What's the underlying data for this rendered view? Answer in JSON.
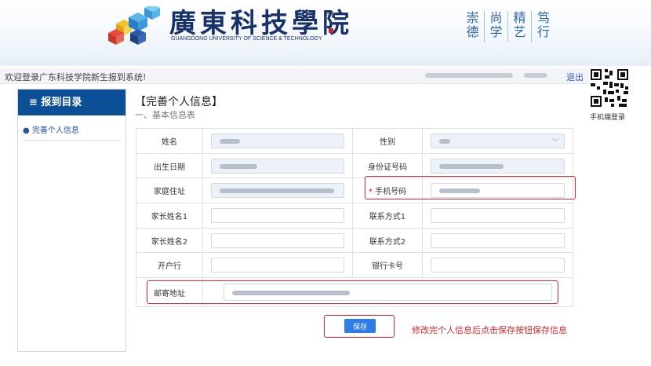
{
  "header": {
    "school_name": "廣東科技學院",
    "school_name_en": "GUANGDONG UNIVERSITY OF SCIENCE & TECHNOLOGY",
    "seal_text_a": "崇",
    "seal_text_b": "德",
    "motto": [
      "崇德",
      "尚学",
      "精艺",
      "笃行"
    ]
  },
  "topbar": {
    "welcome": "欢迎登录广东科技学院新生报到系统!",
    "logout_label": "退出",
    "qr_label": "手机端登录"
  },
  "sidebar": {
    "title": "≡ 报到目录",
    "items": [
      {
        "label": "● 完善个人信息"
      }
    ]
  },
  "section": {
    "title": "【完善个人信息】",
    "subtitle": "一、基本信息表"
  },
  "form": {
    "labels": {
      "name": "姓名",
      "gender": "性别",
      "birth": "出生日期",
      "id_no": "身份证号码",
      "home": "家庭住址",
      "phone_required_mark": "*",
      "phone": "手机号码",
      "parent1": "家长姓名1",
      "contact1": "联系方式1",
      "parent2": "家长姓名2",
      "contact2": "联系方式2",
      "bank": "开户行",
      "card": "银行卡号",
      "mail_addr": "邮寄地址"
    }
  },
  "actions": {
    "save_label": "保存",
    "hint": "修改完个人信息后点击保存按钮保存信息"
  },
  "colors": {
    "brand": "#0b4f97",
    "accent": "#2f7de6",
    "highlight": "#e0262b"
  }
}
